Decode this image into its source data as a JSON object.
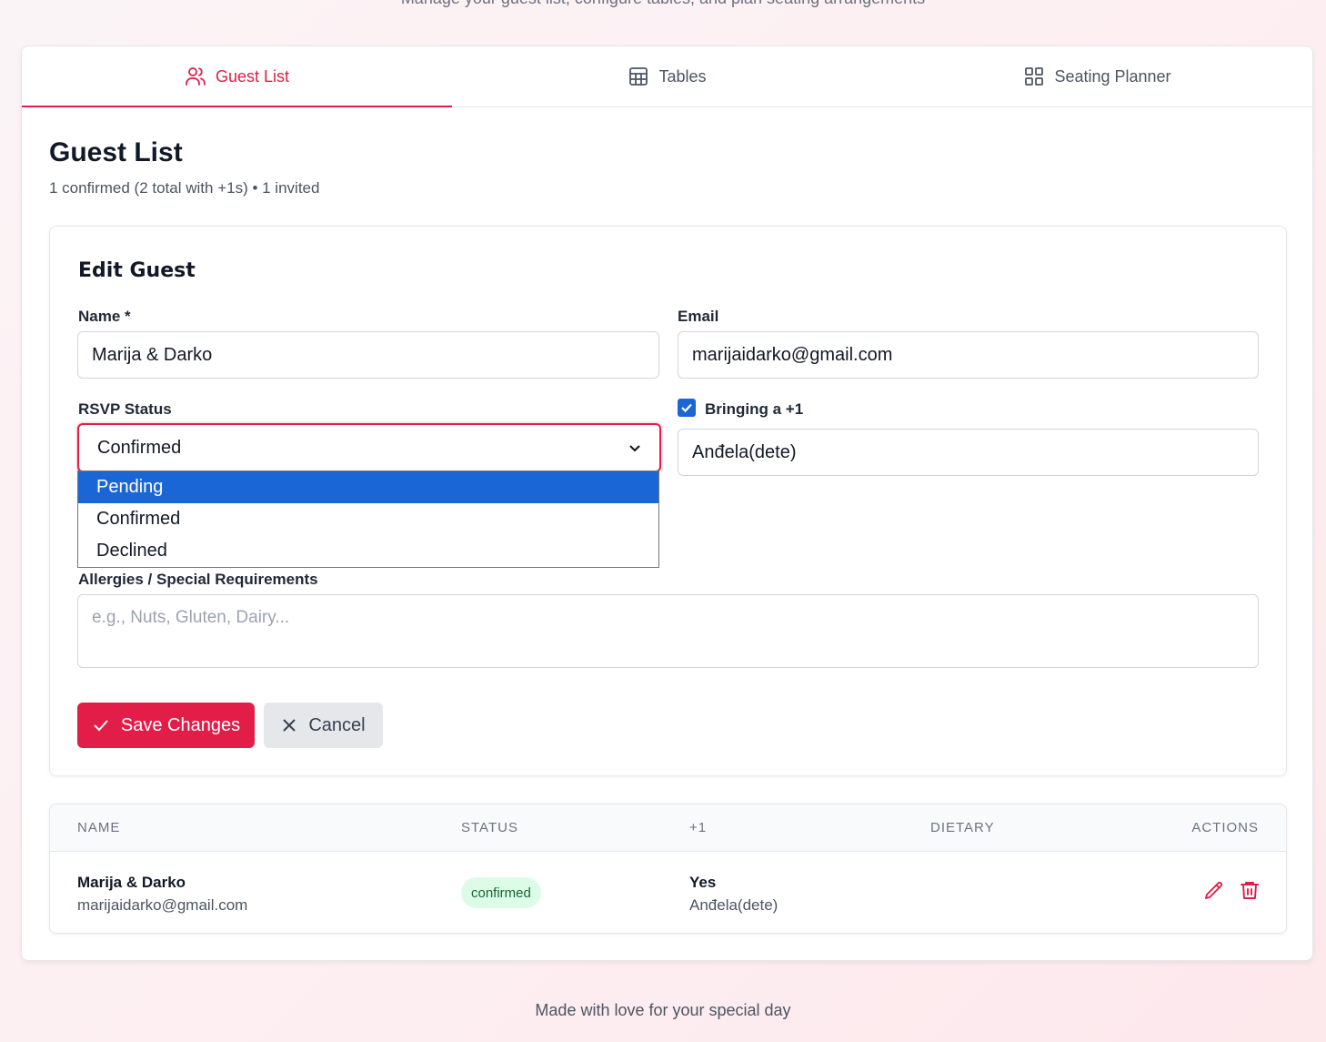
{
  "header": {
    "subtitle": "Manage your guest list, configure tables, and plan seating arrangements"
  },
  "tabs": [
    {
      "label": "Guest List",
      "icon": "users-icon",
      "active": true
    },
    {
      "label": "Tables",
      "icon": "table-icon",
      "active": false
    },
    {
      "label": "Seating Planner",
      "icon": "grid-icon",
      "active": false
    }
  ],
  "page": {
    "title": "Guest List",
    "summary": "1 confirmed (2 total with +1s) • 1 invited"
  },
  "edit_form": {
    "title": "Edit Guest",
    "name_label": "Name *",
    "name_value": "Marija & Darko",
    "email_label": "Email",
    "email_value": "marijaidarko@gmail.com",
    "rsvp_label": "RSVP Status",
    "rsvp_value": "Confirmed",
    "rsvp_options": [
      "Pending",
      "Confirmed",
      "Declined"
    ],
    "plus_one_label": "Bringing a +1",
    "plus_one_checked": true,
    "plus_one_value": "Anđela(dete)",
    "allergies_label": "Allergies / Special Requirements",
    "allergies_placeholder": "e.g., Nuts, Gluten, Dairy...",
    "save_label": "Save Changes",
    "cancel_label": "Cancel"
  },
  "table": {
    "headers": [
      "NAME",
      "STATUS",
      "+1",
      "DIETARY",
      "ACTIONS"
    ],
    "rows": [
      {
        "name": "Marija & Darko",
        "email": "marijaidarko@gmail.com",
        "status": "confirmed",
        "plus_one": "Yes",
        "plus_one_name": "Anđela(dete)",
        "dietary": ""
      }
    ]
  },
  "footer": {
    "text": "Made with love for your special day"
  },
  "colors": {
    "accent": "#e11d48",
    "select_highlight": "#1a66d6",
    "badge_bg": "#dcfce7",
    "badge_text": "#166534"
  }
}
